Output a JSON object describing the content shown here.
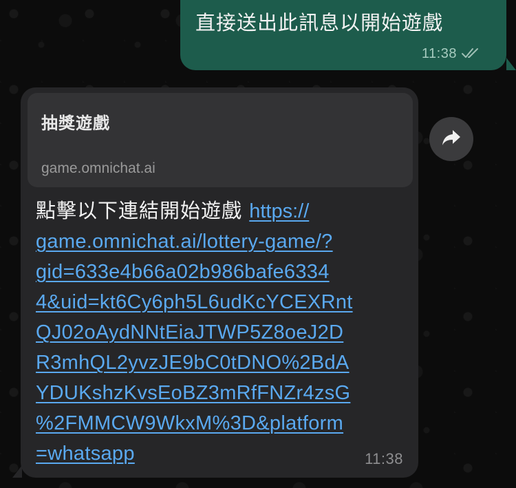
{
  "outgoing": {
    "text": "直接送出此訊息以開始遊戲",
    "time": "11:38",
    "status_icon": "double-check-icon"
  },
  "incoming": {
    "preview": {
      "title": "抽獎遊戲",
      "domain": "game.omnichat.ai"
    },
    "text_prefix": "點擊以下連結開始遊戲 ",
    "link_lines": [
      "https://",
      "game.omnichat.ai/lottery-game/?",
      "gid=633e4b66a02b986bafe6334",
      "4&uid=kt6Cy6ph5L6udKcYCEXRnt",
      "QJ02oAydNNtEiaJTWP5Z8oeJ2D",
      "R3mhQL2yvzJE9bC0tDNO%2BdA",
      "YDUKshzKvsEoBZ3mRfFNZr4zsG",
      "%2FMMCW9WkxM%3D&platform",
      "=whatsapp"
    ],
    "time": "11:38"
  },
  "forward_button": {
    "icon": "forward-arrow-icon"
  },
  "colors": {
    "outgoing_bubble": "#1d5c4c",
    "incoming_bubble": "#262628",
    "link": "#5aa9f0",
    "background": "#0c0c0c"
  }
}
